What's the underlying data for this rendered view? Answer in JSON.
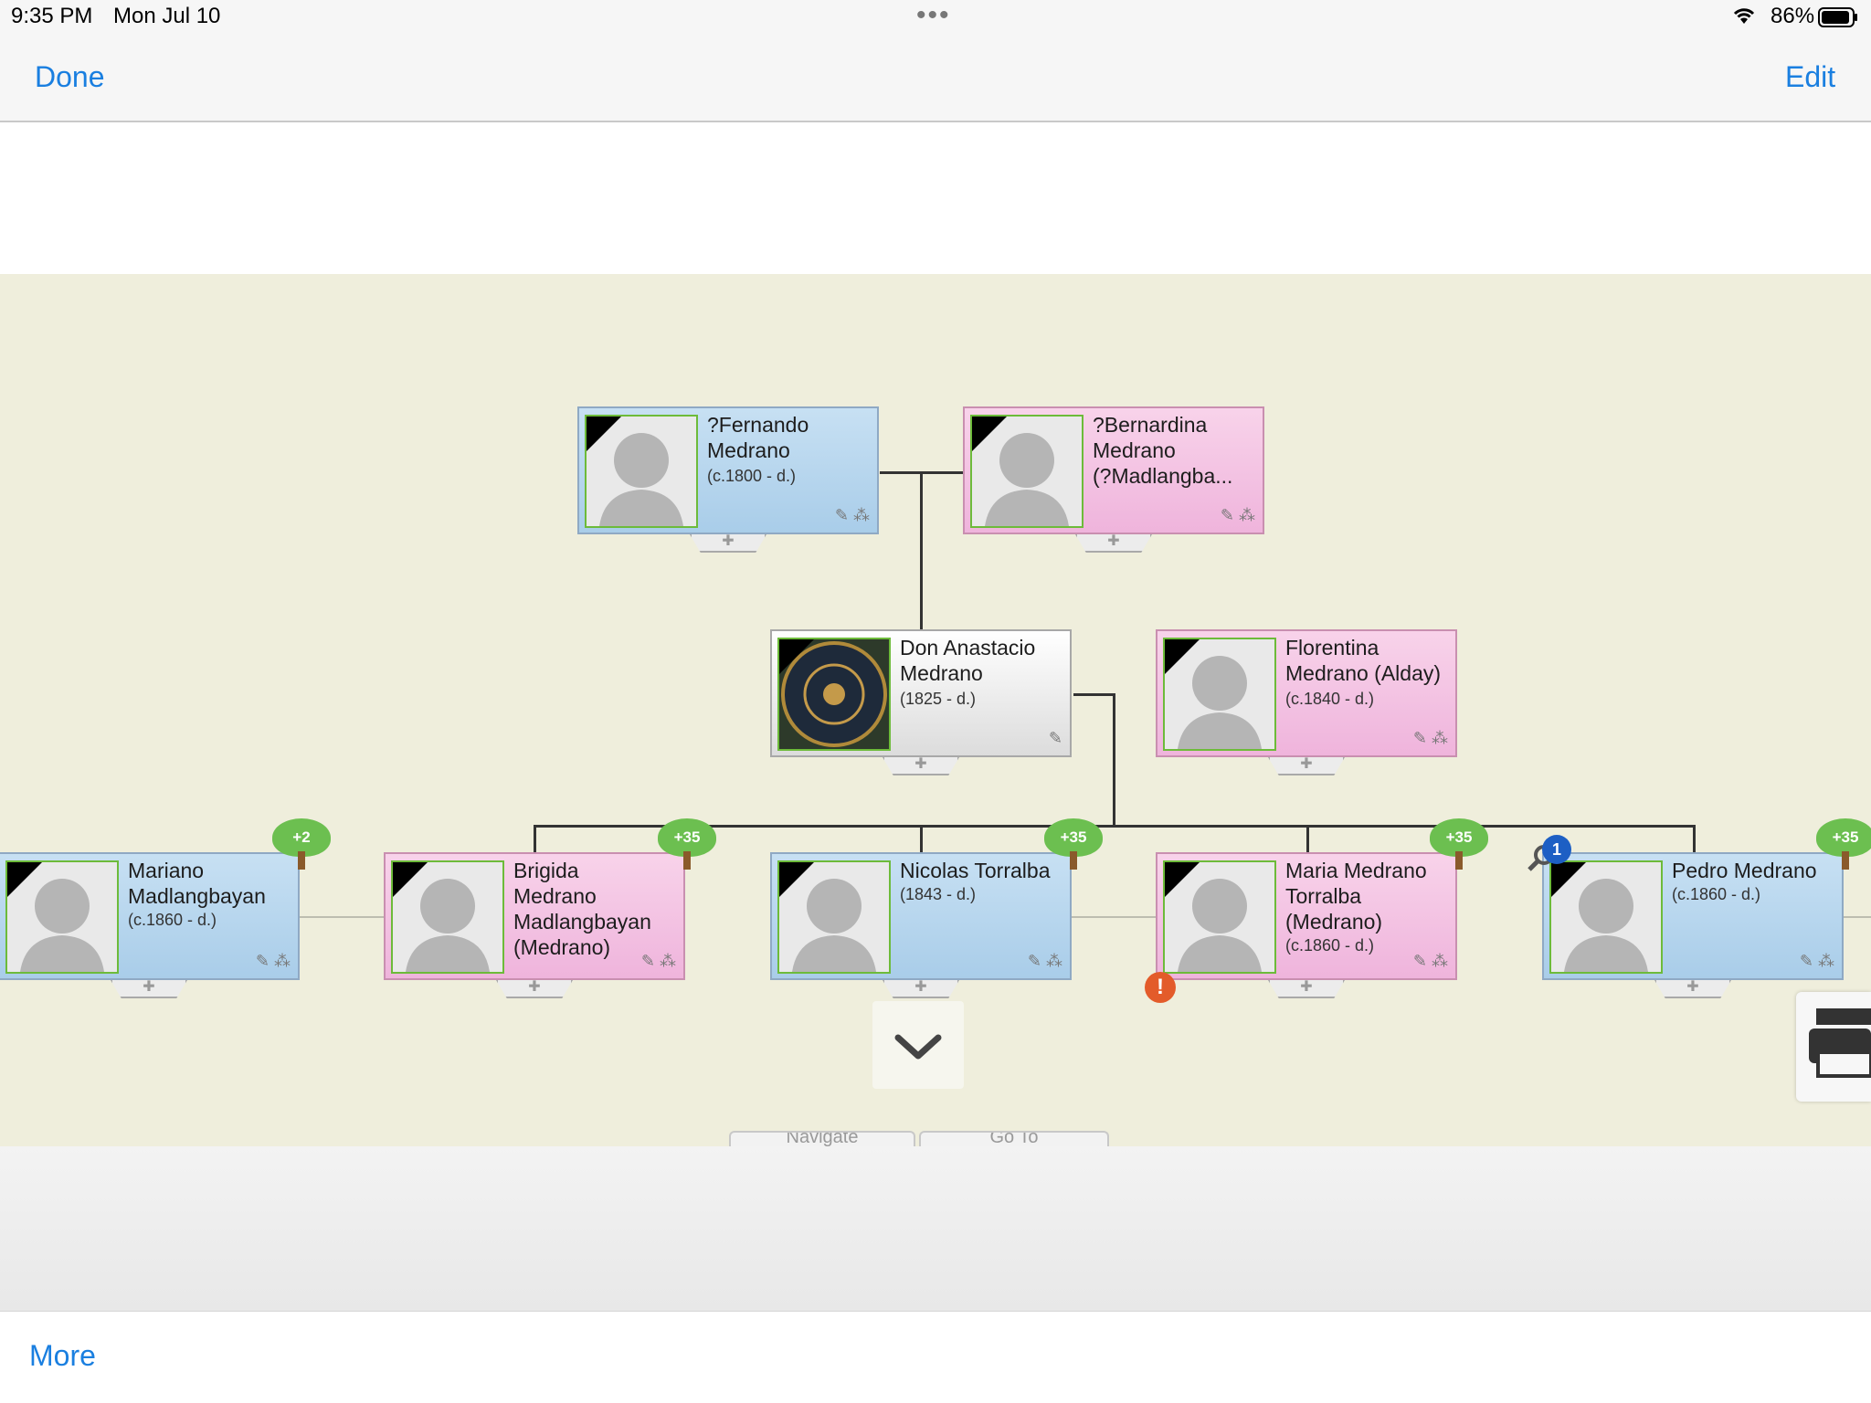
{
  "status": {
    "time": "9:35 PM",
    "date": "Mon Jul 10",
    "battery": "86%"
  },
  "nav": {
    "done": "Done",
    "edit": "Edit"
  },
  "toolbar": {
    "more": "More"
  },
  "bottom_tabs": {
    "navigate": "Navigate",
    "goto": "Go To"
  },
  "people": [
    {
      "name": "?Fernando\nMedrano",
      "dates": "(c.1800 -  d.)",
      "sex": "m"
    },
    {
      "name": "?Bernardina\nMedrano\n(?Madlangba...",
      "dates": "",
      "sex": "f"
    },
    {
      "name": "Don Anastacio\nMedrano",
      "dates": "(1825 -  d.)",
      "sex": "w"
    },
    {
      "name": "Florentina\nMedrano (Alday)",
      "dates": "(c.1840 -  d.)",
      "sex": "f"
    },
    {
      "name": "Mariano\nMadlangbayan",
      "dates": "(c.1860 -  d.)",
      "sex": "m",
      "tree": "+2"
    },
    {
      "name": "Brigida\nMedrano\nMadlangbayan\n(Medrano)",
      "dates": "",
      "sex": "f",
      "tree": "+35"
    },
    {
      "name": "Nicolas Torralba",
      "dates": "(1843 -  d.)",
      "sex": "m",
      "tree": "+35"
    },
    {
      "name": "Maria Medrano\nTorralba\n(Medrano)",
      "dates": "(c.1860 -  d.)",
      "sex": "f",
      "tree": "+35"
    },
    {
      "name": "Pedro Medrano",
      "dates": "(c.1860 -  d.)",
      "sex": "m",
      "tree": "+35"
    }
  ],
  "badges": {
    "hint_count": "1",
    "alert": "!"
  },
  "icons": [
    "wifi-icon",
    "battery-icon",
    "silhouette-icon",
    "edit-pencil-icon",
    "tree-view-icon",
    "add-tab-icon",
    "chevron-down-icon",
    "print-icon",
    "search-hint-icon",
    "alert-icon",
    "family-tree-icon"
  ]
}
